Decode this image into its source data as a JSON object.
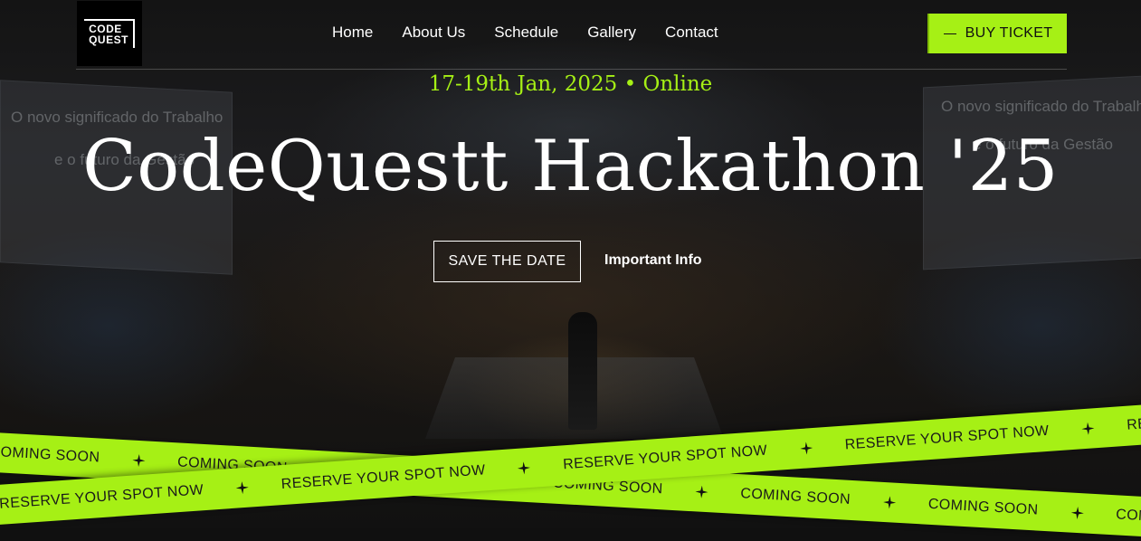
{
  "header": {
    "logo": {
      "line1": "CODE",
      "line2": "QUEST"
    },
    "nav": [
      {
        "label": "Home"
      },
      {
        "label": "About Us"
      },
      {
        "label": "Schedule"
      },
      {
        "label": "Gallery"
      },
      {
        "label": "Contact"
      }
    ],
    "buy_label": "BUY TICKET"
  },
  "background_screens": {
    "left_line1": "O novo significado do Trabalho",
    "left_line2": "e o futuro da Gestão",
    "right_line1": "O novo significado do Trabalho",
    "right_line2": "e o futuro da Gestão"
  },
  "hero": {
    "date": "17-19th Jan, 2025 • Online",
    "title": "CodeQuestt Hackathon '25",
    "save_label": "SAVE THE DATE",
    "info_label": "Important Info"
  },
  "ribbons": {
    "top_text": "COMING SOON",
    "bottom_text": "RESERVE YOUR SPOT NOW"
  },
  "colors": {
    "accent": "#a6f015",
    "background": "#101010",
    "text": "#ffffff"
  },
  "icons": {
    "ribbon_separator": "sparkle-star-icon",
    "buy_ticket_prefix": "dash-icon"
  }
}
